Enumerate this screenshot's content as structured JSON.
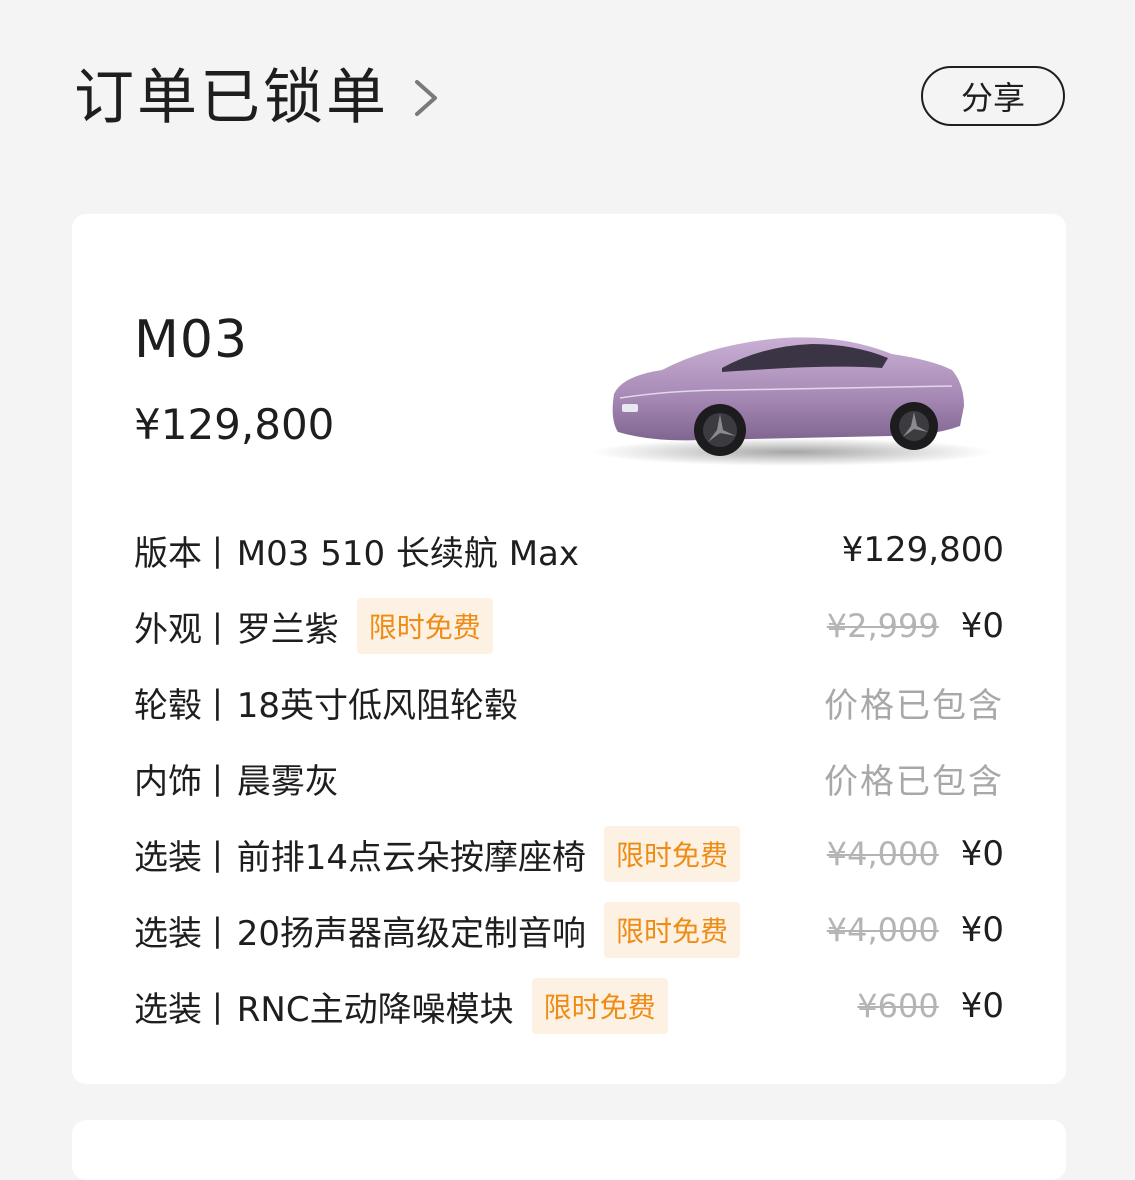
{
  "header": {
    "title": "订单已锁单",
    "share_label": "分享"
  },
  "card": {
    "model": "M03",
    "price": "¥129,800",
    "rows": [
      {
        "label": "版本",
        "value": "M03 510 长续航 Max",
        "tag": "",
        "original_price": "",
        "price": "¥129,800"
      },
      {
        "label": "外观",
        "value": "罗兰紫",
        "tag": "限时免费",
        "original_price": "¥2,999",
        "price": "¥0"
      },
      {
        "label": "轮毂",
        "value": "18英寸低风阻轮毂",
        "tag": "",
        "original_price": "",
        "price": "价格已包含"
      },
      {
        "label": "内饰",
        "value": "晨雾灰",
        "tag": "",
        "original_price": "",
        "price": "价格已包含"
      },
      {
        "label": "选装",
        "value": "前排14点云朵按摩座椅",
        "tag": "限时免费",
        "original_price": "¥4,000",
        "price": "¥0"
      },
      {
        "label": "选装",
        "value": "20扬声器高级定制音响",
        "tag": "限时免费",
        "original_price": "¥4,000",
        "price": "¥0"
      },
      {
        "label": "选装",
        "value": "RNC主动降噪模块",
        "tag": "限时免费",
        "original_price": "¥600",
        "price": "¥0"
      }
    ]
  },
  "colors": {
    "tag_bg": "#fdf1e4",
    "tag_text": "#ee8c15",
    "car_body": "#b89ac4",
    "page_bg": "#f4f4f4"
  },
  "icons": [
    "chevron-right-icon",
    "car-image"
  ]
}
